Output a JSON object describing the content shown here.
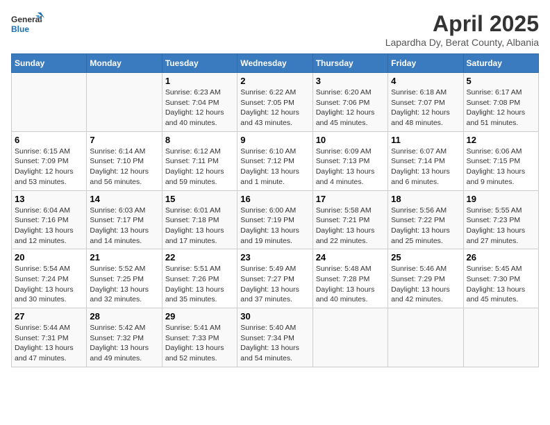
{
  "header": {
    "logo": {
      "general": "General",
      "blue": "Blue"
    },
    "title": "April 2025",
    "location": "Lapardha Dy, Berat County, Albania"
  },
  "calendar": {
    "weekdays": [
      "Sunday",
      "Monday",
      "Tuesday",
      "Wednesday",
      "Thursday",
      "Friday",
      "Saturday"
    ],
    "weeks": [
      [
        {
          "day": "",
          "info": ""
        },
        {
          "day": "",
          "info": ""
        },
        {
          "day": "1",
          "info": "Sunrise: 6:23 AM\nSunset: 7:04 PM\nDaylight: 12 hours and 40 minutes."
        },
        {
          "day": "2",
          "info": "Sunrise: 6:22 AM\nSunset: 7:05 PM\nDaylight: 12 hours and 43 minutes."
        },
        {
          "day": "3",
          "info": "Sunrise: 6:20 AM\nSunset: 7:06 PM\nDaylight: 12 hours and 45 minutes."
        },
        {
          "day": "4",
          "info": "Sunrise: 6:18 AM\nSunset: 7:07 PM\nDaylight: 12 hours and 48 minutes."
        },
        {
          "day": "5",
          "info": "Sunrise: 6:17 AM\nSunset: 7:08 PM\nDaylight: 12 hours and 51 minutes."
        }
      ],
      [
        {
          "day": "6",
          "info": "Sunrise: 6:15 AM\nSunset: 7:09 PM\nDaylight: 12 hours and 53 minutes."
        },
        {
          "day": "7",
          "info": "Sunrise: 6:14 AM\nSunset: 7:10 PM\nDaylight: 12 hours and 56 minutes."
        },
        {
          "day": "8",
          "info": "Sunrise: 6:12 AM\nSunset: 7:11 PM\nDaylight: 12 hours and 59 minutes."
        },
        {
          "day": "9",
          "info": "Sunrise: 6:10 AM\nSunset: 7:12 PM\nDaylight: 13 hours and 1 minute."
        },
        {
          "day": "10",
          "info": "Sunrise: 6:09 AM\nSunset: 7:13 PM\nDaylight: 13 hours and 4 minutes."
        },
        {
          "day": "11",
          "info": "Sunrise: 6:07 AM\nSunset: 7:14 PM\nDaylight: 13 hours and 6 minutes."
        },
        {
          "day": "12",
          "info": "Sunrise: 6:06 AM\nSunset: 7:15 PM\nDaylight: 13 hours and 9 minutes."
        }
      ],
      [
        {
          "day": "13",
          "info": "Sunrise: 6:04 AM\nSunset: 7:16 PM\nDaylight: 13 hours and 12 minutes."
        },
        {
          "day": "14",
          "info": "Sunrise: 6:03 AM\nSunset: 7:17 PM\nDaylight: 13 hours and 14 minutes."
        },
        {
          "day": "15",
          "info": "Sunrise: 6:01 AM\nSunset: 7:18 PM\nDaylight: 13 hours and 17 minutes."
        },
        {
          "day": "16",
          "info": "Sunrise: 6:00 AM\nSunset: 7:19 PM\nDaylight: 13 hours and 19 minutes."
        },
        {
          "day": "17",
          "info": "Sunrise: 5:58 AM\nSunset: 7:21 PM\nDaylight: 13 hours and 22 minutes."
        },
        {
          "day": "18",
          "info": "Sunrise: 5:56 AM\nSunset: 7:22 PM\nDaylight: 13 hours and 25 minutes."
        },
        {
          "day": "19",
          "info": "Sunrise: 5:55 AM\nSunset: 7:23 PM\nDaylight: 13 hours and 27 minutes."
        }
      ],
      [
        {
          "day": "20",
          "info": "Sunrise: 5:54 AM\nSunset: 7:24 PM\nDaylight: 13 hours and 30 minutes."
        },
        {
          "day": "21",
          "info": "Sunrise: 5:52 AM\nSunset: 7:25 PM\nDaylight: 13 hours and 32 minutes."
        },
        {
          "day": "22",
          "info": "Sunrise: 5:51 AM\nSunset: 7:26 PM\nDaylight: 13 hours and 35 minutes."
        },
        {
          "day": "23",
          "info": "Sunrise: 5:49 AM\nSunset: 7:27 PM\nDaylight: 13 hours and 37 minutes."
        },
        {
          "day": "24",
          "info": "Sunrise: 5:48 AM\nSunset: 7:28 PM\nDaylight: 13 hours and 40 minutes."
        },
        {
          "day": "25",
          "info": "Sunrise: 5:46 AM\nSunset: 7:29 PM\nDaylight: 13 hours and 42 minutes."
        },
        {
          "day": "26",
          "info": "Sunrise: 5:45 AM\nSunset: 7:30 PM\nDaylight: 13 hours and 45 minutes."
        }
      ],
      [
        {
          "day": "27",
          "info": "Sunrise: 5:44 AM\nSunset: 7:31 PM\nDaylight: 13 hours and 47 minutes."
        },
        {
          "day": "28",
          "info": "Sunrise: 5:42 AM\nSunset: 7:32 PM\nDaylight: 13 hours and 49 minutes."
        },
        {
          "day": "29",
          "info": "Sunrise: 5:41 AM\nSunset: 7:33 PM\nDaylight: 13 hours and 52 minutes."
        },
        {
          "day": "30",
          "info": "Sunrise: 5:40 AM\nSunset: 7:34 PM\nDaylight: 13 hours and 54 minutes."
        },
        {
          "day": "",
          "info": ""
        },
        {
          "day": "",
          "info": ""
        },
        {
          "day": "",
          "info": ""
        }
      ]
    ]
  }
}
